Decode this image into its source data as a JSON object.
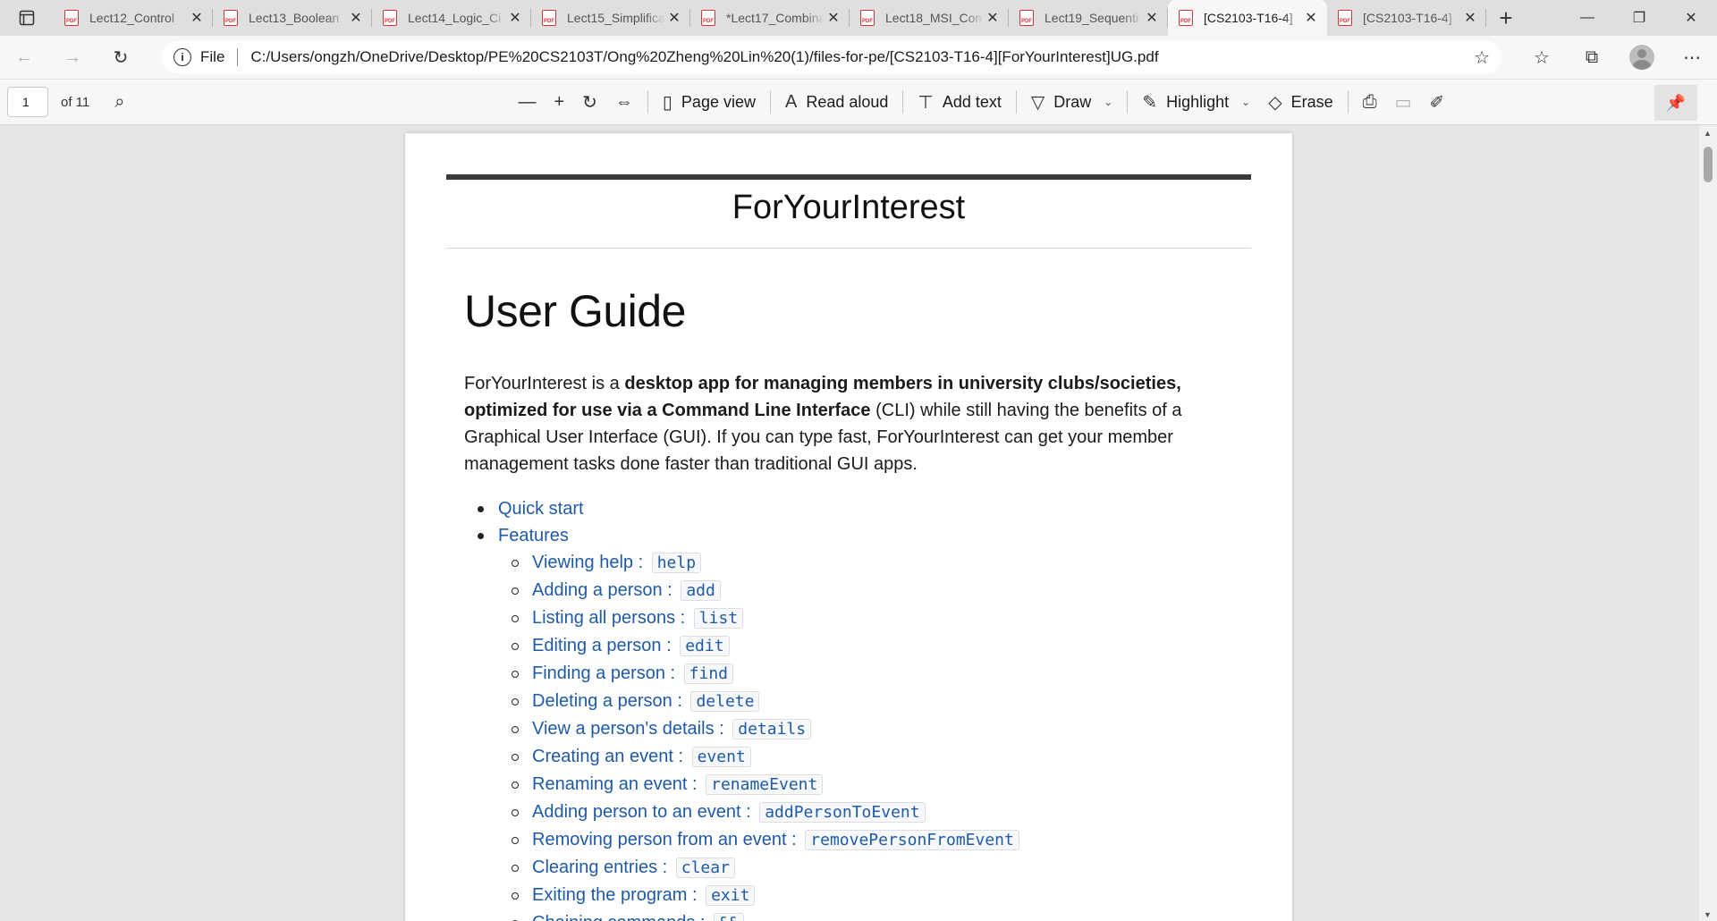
{
  "tabs": [
    {
      "title": "Lect12_Control",
      "active": false
    },
    {
      "title": "Lect13_Boolean",
      "active": false
    },
    {
      "title": "Lect14_Logic_Ci",
      "active": false
    },
    {
      "title": "Lect15_Simplifica",
      "active": false
    },
    {
      "title": "*Lect17_Combina",
      "active": false
    },
    {
      "title": "Lect18_MSI_Com",
      "active": false
    },
    {
      "title": "Lect19_Sequenti",
      "active": false
    },
    {
      "title": "[CS2103-T16-4]",
      "active": true
    },
    {
      "title": "[CS2103-T16-4]",
      "active": false
    }
  ],
  "address": {
    "file_label": "File",
    "url": "C:/Users/ongzh/OneDrive/Desktop/PE%20CS2103T/Ong%20Zheng%20Lin%20(1)/files-for-pe/[CS2103-T16-4][ForYourInterest]UG.pdf"
  },
  "pdf_toolbar": {
    "page_number": "1",
    "page_count": "of 11",
    "page_view": "Page view",
    "read_aloud": "Read aloud",
    "add_text": "Add text",
    "draw": "Draw",
    "highlight": "Highlight",
    "erase": "Erase"
  },
  "document": {
    "header_title": "ForYourInterest",
    "heading": "User Guide",
    "intro_start": "ForYourInterest is a ",
    "intro_bold_1": "desktop app for managing members in university clubs/societies, optimized for use via a Command Line Interface",
    "intro_end": " (CLI) while still having the benefits of a Graphical User Interface (GUI). If you can type fast, ForYourInterest can get your member management tasks done faster than traditional GUI apps.",
    "toc": {
      "quick_start": "Quick start",
      "features": "Features",
      "items": [
        {
          "label": "Viewing help : ",
          "code": "help"
        },
        {
          "label": "Adding a person : ",
          "code": "add"
        },
        {
          "label": "Listing all persons : ",
          "code": "list"
        },
        {
          "label": "Editing a person : ",
          "code": "edit"
        },
        {
          "label": "Finding a person : ",
          "code": "find"
        },
        {
          "label": "Deleting a person : ",
          "code": "delete"
        },
        {
          "label": "View a person's details : ",
          "code": "details"
        },
        {
          "label": "Creating an event : ",
          "code": "event"
        },
        {
          "label": "Renaming an event : ",
          "code": "renameEvent"
        },
        {
          "label": "Adding person to an event : ",
          "code": "addPersonToEvent"
        },
        {
          "label": "Removing person from an event : ",
          "code": "removePersonFromEvent"
        },
        {
          "label": "Clearing entries : ",
          "code": "clear"
        },
        {
          "label": "Exiting the program : ",
          "code": "exit"
        },
        {
          "label": "Chaining commands : ",
          "code": "&&"
        }
      ]
    }
  }
}
